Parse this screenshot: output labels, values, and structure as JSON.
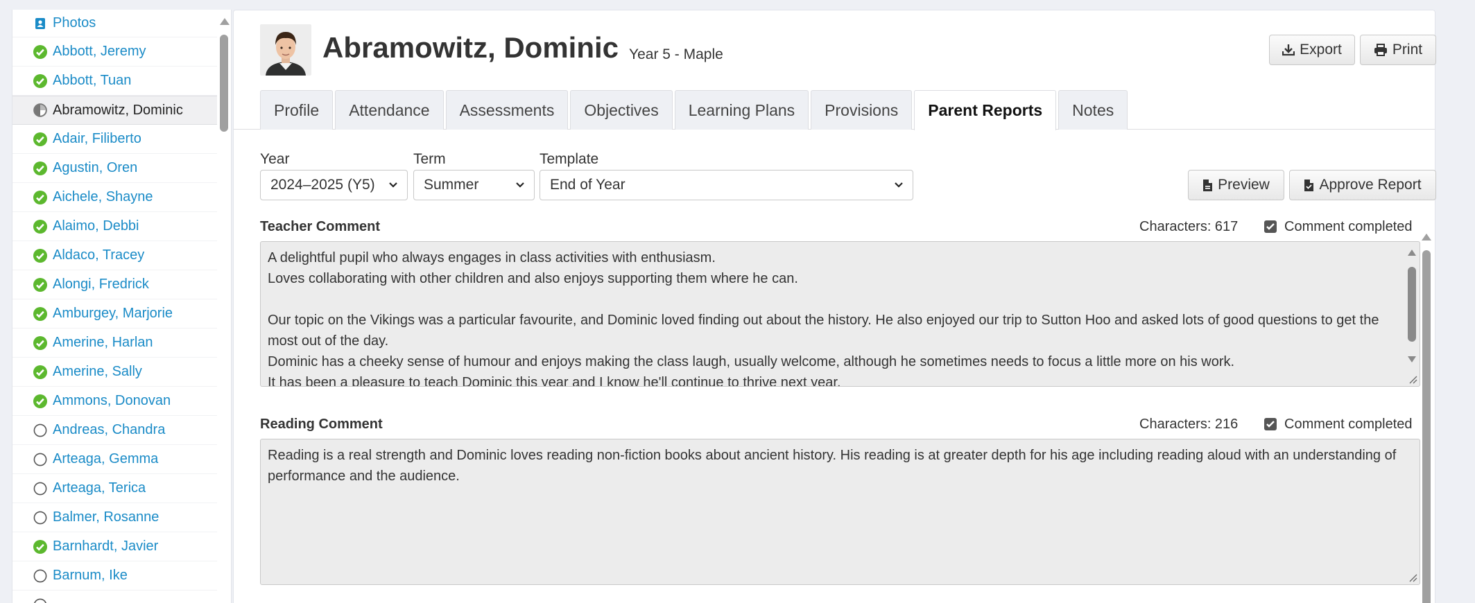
{
  "sidebar": {
    "header": "Photos",
    "students": [
      {
        "name": "Abbott, Jeremy",
        "status": "complete"
      },
      {
        "name": "Abbott, Tuan",
        "status": "complete"
      },
      {
        "name": "Abramowitz, Dominic",
        "status": "partial",
        "active": true
      },
      {
        "name": "Adair, Filiberto",
        "status": "complete"
      },
      {
        "name": "Agustin, Oren",
        "status": "complete"
      },
      {
        "name": "Aichele, Shayne",
        "status": "complete"
      },
      {
        "name": "Alaimo, Debbi",
        "status": "complete"
      },
      {
        "name": "Aldaco, Tracey",
        "status": "complete"
      },
      {
        "name": "Alongi, Fredrick",
        "status": "complete"
      },
      {
        "name": "Amburgey, Marjorie",
        "status": "complete"
      },
      {
        "name": "Amerine, Harlan",
        "status": "complete"
      },
      {
        "name": "Amerine, Sally",
        "status": "complete"
      },
      {
        "name": "Ammons, Donovan",
        "status": "complete"
      },
      {
        "name": "Andreas, Chandra",
        "status": "none"
      },
      {
        "name": "Arteaga, Gemma",
        "status": "none"
      },
      {
        "name": "Arteaga, Terica",
        "status": "none"
      },
      {
        "name": "Balmer, Rosanne",
        "status": "none"
      },
      {
        "name": "Barnhardt, Javier",
        "status": "complete"
      },
      {
        "name": "Barnum, Ike",
        "status": "none"
      },
      {
        "name": "",
        "status": "none"
      }
    ]
  },
  "student": {
    "name": "Abramowitz, Dominic",
    "class": "Year 5 - Maple"
  },
  "toolbar": {
    "export_label": "Export",
    "print_label": "Print",
    "preview_label": "Preview",
    "approve_label": "Approve Report"
  },
  "tabs": [
    {
      "label": "Profile",
      "active": false
    },
    {
      "label": "Attendance",
      "active": false
    },
    {
      "label": "Assessments",
      "active": false
    },
    {
      "label": "Objectives",
      "active": false
    },
    {
      "label": "Learning Plans",
      "active": false
    },
    {
      "label": "Provisions",
      "active": false
    },
    {
      "label": "Parent Reports",
      "active": true
    },
    {
      "label": "Notes",
      "active": false
    }
  ],
  "filters": {
    "year": {
      "label": "Year",
      "value": "2024–2025 (Y5)"
    },
    "term": {
      "label": "Term",
      "value": "Summer"
    },
    "template": {
      "label": "Template",
      "value": "End of Year"
    }
  },
  "teacher_comment": {
    "title": "Teacher Comment",
    "chars": "Characters: 617",
    "completed_label": "Comment completed",
    "text": "A delightful pupil who always engages in class activities with enthusiasm.\nLoves collaborating with other children and also enjoys supporting them where he can.\n\nOur topic on the Vikings was a particular favourite, and Dominic loved finding out about the history. He also enjoyed our trip to Sutton Hoo and asked lots of good questions to get the most out of the day.\nDominic has a cheeky sense of humour and enjoys making the class laugh, usually welcome, although he sometimes needs to focus a little more on his work.\nIt has been a pleasure to teach Dominic this year and I know he'll continue to thrive next year."
  },
  "reading_comment": {
    "title": "Reading Comment",
    "chars": "Characters: 216",
    "completed_label": "Comment completed",
    "text": "Reading is a real strength and Dominic loves reading non-fiction books about ancient history. His reading is at greater depth for his age including reading aloud with an understanding of performance and the audience."
  },
  "colors": {
    "link": "#1a8bc7",
    "complete": "#5cb82e",
    "partial": "#777777"
  },
  "icons": {
    "complete": "check-circle-icon",
    "partial": "half-circle-icon",
    "none": "empty-circle-icon"
  }
}
